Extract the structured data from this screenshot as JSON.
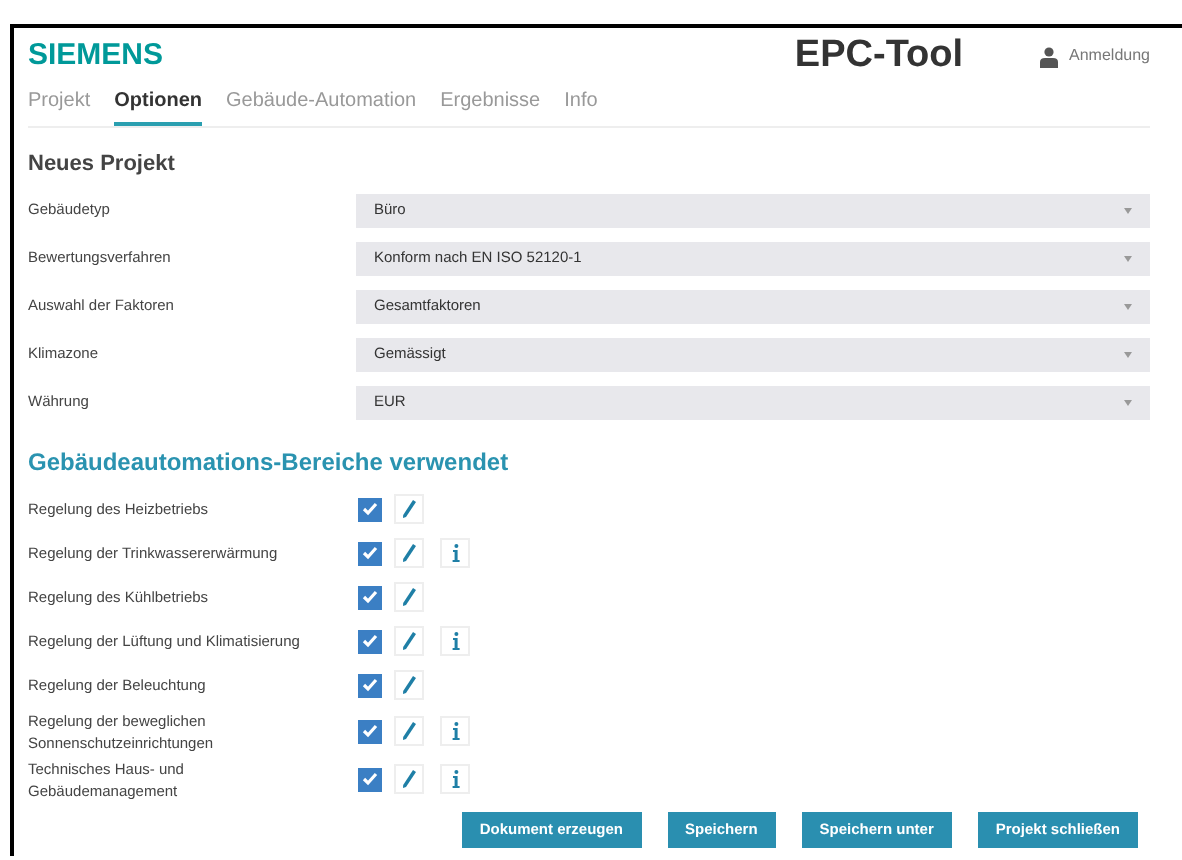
{
  "header": {
    "logo": "SIEMENS",
    "app_title": "EPC-Tool",
    "login": "Anmeldung"
  },
  "tabs": [
    {
      "label": "Projekt",
      "selected": false
    },
    {
      "label": "Optionen",
      "selected": true
    },
    {
      "label": "Gebäude-Automation",
      "selected": false
    },
    {
      "label": "Ergebnisse",
      "selected": false
    },
    {
      "label": "Info",
      "selected": false
    }
  ],
  "project": {
    "title": "Neues Projekt",
    "fields": [
      {
        "label": "Gebäudetyp",
        "value": "Büro"
      },
      {
        "label": "Bewertungsverfahren",
        "value": "Konform nach EN ISO 52120-1"
      },
      {
        "label": "Auswahl der Faktoren",
        "value": "Gesamtfaktoren"
      },
      {
        "label": "Klimazone",
        "value": "Gemässigt"
      },
      {
        "label": "Währung",
        "value": "EUR"
      }
    ]
  },
  "areas": {
    "title": "Gebäudeautomations-Bereiche verwendet",
    "items": [
      {
        "label": "Regelung des Heizbetriebs",
        "checked": true,
        "info": false
      },
      {
        "label": "Regelung der Trinkwassererwärmung",
        "checked": true,
        "info": true
      },
      {
        "label": "Regelung des Kühlbetriebs",
        "checked": true,
        "info": false
      },
      {
        "label": "Regelung der Lüftung und Klimatisierung",
        "checked": true,
        "info": true
      },
      {
        "label": "Regelung der Beleuchtung",
        "checked": true,
        "info": false
      },
      {
        "label": "Regelung der beweglichen Sonnenschutzeinrichtungen",
        "checked": true,
        "info": true
      },
      {
        "label": "Technisches Haus- und Gebäudemanagement",
        "checked": true,
        "info": true
      }
    ]
  },
  "buttons": [
    "Dokument erzeugen",
    "Speichern",
    "Speichern unter",
    "Projekt schließen"
  ]
}
